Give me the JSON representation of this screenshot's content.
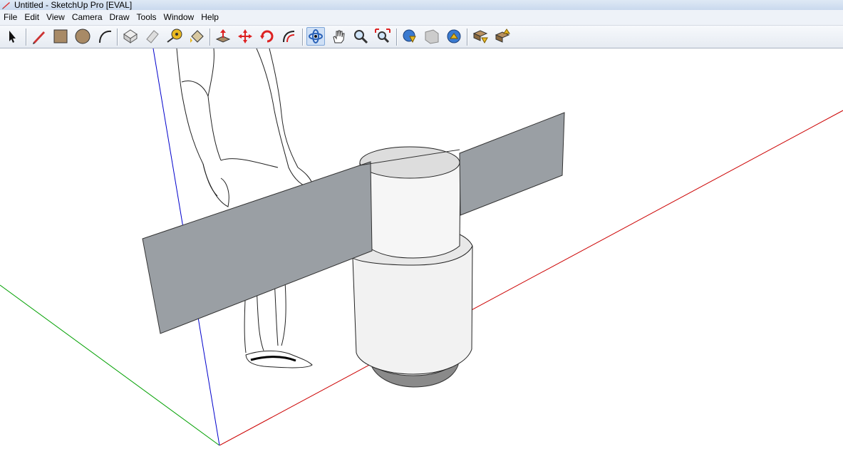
{
  "window": {
    "title": "Untitled - SketchUp Pro [EVAL]"
  },
  "menu": [
    "File",
    "Edit",
    "View",
    "Camera",
    "Draw",
    "Tools",
    "Window",
    "Help"
  ],
  "toolbar": {
    "tools": [
      {
        "name": "select-tool",
        "icon": "arrow-cursor-icon"
      },
      {
        "name": "line-tool",
        "icon": "pencil-icon"
      },
      {
        "name": "rectangle-tool",
        "icon": "rectangle-icon"
      },
      {
        "name": "circle-tool",
        "icon": "circle-icon"
      },
      {
        "name": "arc-tool",
        "icon": "arc-icon"
      },
      {
        "name": "make-component-tool",
        "icon": "component-icon"
      },
      {
        "name": "eraser-tool",
        "icon": "eraser-icon"
      },
      {
        "name": "tape-measure-tool",
        "icon": "tape-measure-icon"
      },
      {
        "name": "paint-bucket-tool",
        "icon": "paint-bucket-icon"
      },
      {
        "name": "push-pull-tool",
        "icon": "push-pull-icon"
      },
      {
        "name": "move-tool",
        "icon": "move-icon"
      },
      {
        "name": "rotate-tool",
        "icon": "rotate-icon"
      },
      {
        "name": "offset-tool",
        "icon": "offset-icon"
      },
      {
        "name": "orbit-tool",
        "icon": "orbit-icon",
        "active": true
      },
      {
        "name": "pan-tool",
        "icon": "hand-icon"
      },
      {
        "name": "zoom-tool",
        "icon": "magnifier-icon"
      },
      {
        "name": "zoom-extents-tool",
        "icon": "zoom-extents-icon"
      },
      {
        "name": "get-models-tool",
        "icon": "globe-download-icon"
      },
      {
        "name": "share-model-tool",
        "icon": "share-model-icon"
      },
      {
        "name": "google-earth-tool",
        "icon": "globe-upload-icon"
      },
      {
        "name": "get-components-tool",
        "icon": "components-download-icon"
      },
      {
        "name": "share-component-tool",
        "icon": "components-upload-icon"
      }
    ]
  },
  "colors": {
    "axis_red": "#cc0000",
    "axis_green": "#00a000",
    "axis_blue": "#0000cc",
    "plane_fill": "#9a9fa4",
    "cylinder_fill": "#f4f4f4",
    "shadow_fill": "#8a8a8a"
  }
}
